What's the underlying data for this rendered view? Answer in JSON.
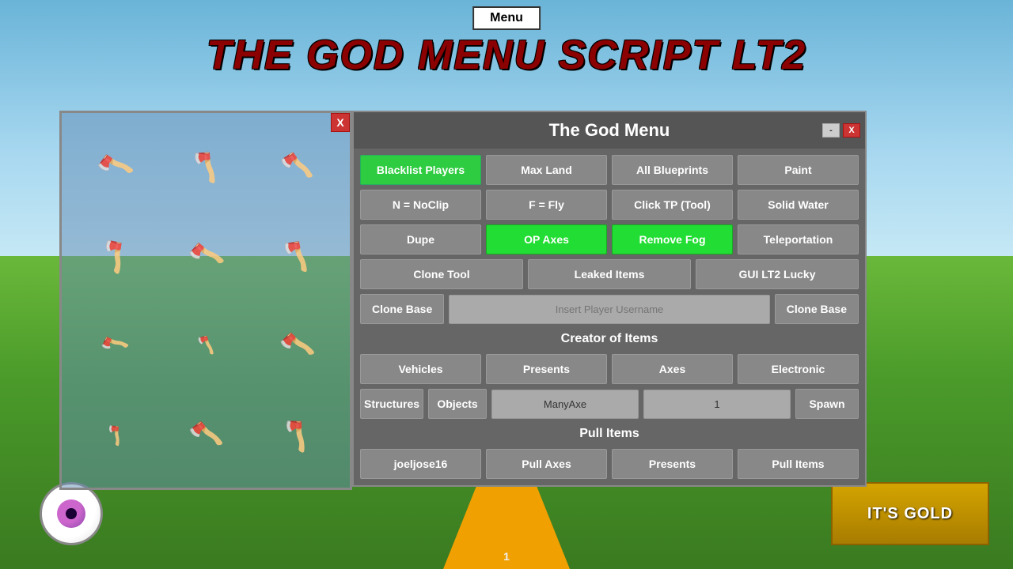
{
  "page": {
    "title": "THE GOD MENU SCRIPT LT2",
    "menu_top_button": "Menu",
    "page_number": "1"
  },
  "window": {
    "title": "The God Menu",
    "minimize_label": "-",
    "close_label": "X",
    "close_left_label": "X"
  },
  "buttons": {
    "row1": [
      {
        "label": "Blacklist Players",
        "style": "green",
        "name": "blacklist-players-btn"
      },
      {
        "label": "Max Land",
        "style": "normal",
        "name": "max-land-btn"
      },
      {
        "label": "All Blueprints",
        "style": "normal",
        "name": "all-blueprints-btn"
      },
      {
        "label": "Paint",
        "style": "normal",
        "name": "paint-btn"
      }
    ],
    "row2": [
      {
        "label": "N = NoClip",
        "style": "normal",
        "name": "noclip-btn"
      },
      {
        "label": "F = Fly",
        "style": "normal",
        "name": "fly-btn"
      },
      {
        "label": "Click TP (Tool)",
        "style": "normal",
        "name": "click-tp-btn"
      },
      {
        "label": "Solid Water",
        "style": "normal",
        "name": "solid-water-btn"
      }
    ],
    "row3": [
      {
        "label": "Dupe",
        "style": "normal",
        "name": "dupe-btn"
      },
      {
        "label": "OP Axes",
        "style": "bright-green",
        "name": "op-axes-btn"
      },
      {
        "label": "Remove Fog",
        "style": "bright-green",
        "name": "remove-fog-btn"
      },
      {
        "label": "Teleportation",
        "style": "normal",
        "name": "teleportation-btn"
      }
    ],
    "row4": [
      {
        "label": "Clone Tool",
        "style": "normal",
        "name": "clone-tool-btn"
      },
      {
        "label": "Leaked Items",
        "style": "normal",
        "name": "leaked-items-btn"
      },
      {
        "label": "GUI LT2 Lucky",
        "style": "normal",
        "name": "gui-lt2-lucky-btn"
      }
    ]
  },
  "clone_base": {
    "label": "Clone Base",
    "placeholder": "Insert Player Username",
    "button_label": "Clone Base"
  },
  "creator_of_items": {
    "section_label": "Creator of Items",
    "row1": [
      {
        "label": "Vehicles",
        "name": "vehicles-btn"
      },
      {
        "label": "Presents",
        "name": "presents-btn"
      },
      {
        "label": "Axes",
        "name": "axes-btn"
      },
      {
        "label": "Electronic",
        "name": "electronic-btn"
      }
    ],
    "row2_left": [
      {
        "label": "Structures",
        "name": "structures-btn"
      },
      {
        "label": "Objects",
        "name": "objects-btn"
      }
    ],
    "many_axe_value": "ManyAxe",
    "quantity_value": "1",
    "spawn_label": "Spawn"
  },
  "pull_items": {
    "section_label": "Pull Items",
    "player_label": "joeljose16",
    "pull_axes_label": "Pull Axes",
    "presents_label": "Presents",
    "pull_items_label": "Pull Items"
  },
  "gold_sign": {
    "text": "IT'S GOLD"
  }
}
